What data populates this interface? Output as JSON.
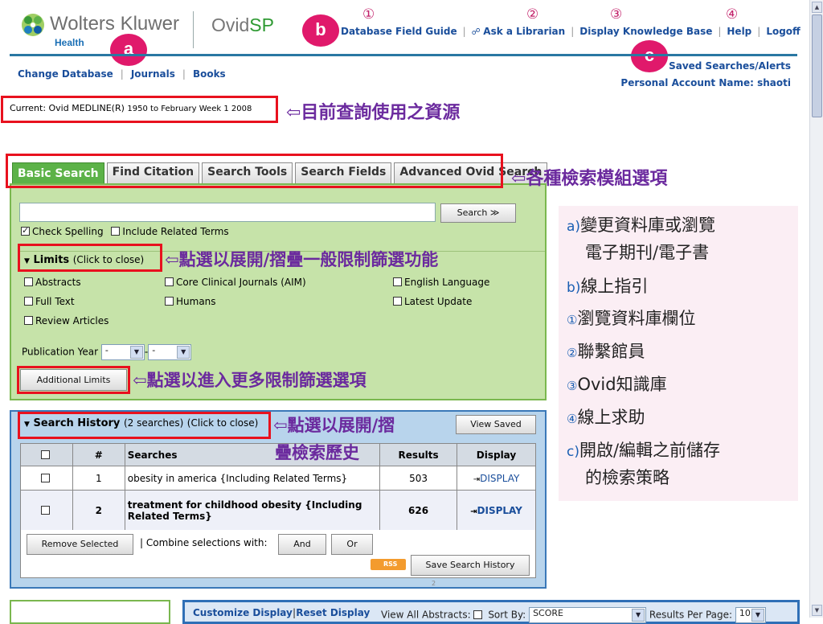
{
  "brand": {
    "name": "Wolters Kluwer",
    "sub": "Health",
    "ovid_a": "Ovid",
    "ovid_b": "SP"
  },
  "markers": {
    "a": "a",
    "b": "b",
    "c": "c",
    "n1": "①",
    "n2": "②",
    "n3": "③",
    "n4": "④"
  },
  "toplinks": {
    "field_guide": "Database Field Guide",
    "librarian": "Ask a Librarian",
    "knowledge": "Display Knowledge Base",
    "help": "Help",
    "logoff": "Logoff"
  },
  "nav": {
    "change_db": "Change Database",
    "journals": "Journals",
    "books": "Books",
    "saved": "Saved Searches/Alerts",
    "account": "Personal Account Name: shaoti"
  },
  "current_db": {
    "label": "Current: Ovid MEDLINE(R)",
    "range": "1950 to February Week 1 2008"
  },
  "annotations": {
    "current": "⇦目前查詢使用之資源",
    "tabs": "⇦各種檢索模組選項",
    "limits": "⇦點選以展開/摺疊一般限制篩選功能",
    "additional": "⇦點選以進入更多限制篩選選項",
    "history1": "⇦點選以展開/摺",
    "history2": "疊檢索歷史"
  },
  "tabs": [
    "Basic Search",
    "Find Citation",
    "Search Tools",
    "Search Fields",
    "Advanced Ovid Search"
  ],
  "search": {
    "input_value": "",
    "button": "Search ≫",
    "check_spelling": "Check Spelling",
    "related_terms": "Include Related Terms"
  },
  "limits": {
    "title": "Limits",
    "sub": "(Click to close)",
    "col1": [
      "Abstracts",
      "Full Text",
      "Review Articles"
    ],
    "col2": [
      "Core Clinical Journals (AIM)",
      "Humans"
    ],
    "col3": [
      "English Language",
      "Latest Update"
    ],
    "pub_year_label": "Publication Year",
    "year_from": "-",
    "year_to": "-",
    "additional_button": "Additional Limits"
  },
  "history": {
    "title": "Search History",
    "count": "(2 searches)",
    "sub": "(Click to close)",
    "view_saved": "View Saved",
    "headers": [
      "#",
      "Searches",
      "Results",
      "Display"
    ],
    "rows": [
      {
        "num": "1",
        "query": "obesity in america {Including Related Terms}",
        "results": "503",
        "display": "DISPLAY"
      },
      {
        "num": "2",
        "query": "treatment for childhood obesity {Including Related Terms}",
        "results": "626",
        "display": "DISPLAY"
      }
    ],
    "remove": "Remove Selected",
    "combine": "| Combine selections with:",
    "and": "And",
    "or": "Or",
    "rss": "RSS",
    "save": "Save Search History",
    "page": "2"
  },
  "legend": {
    "a1": "變更資料庫或瀏覽",
    "a2": "電子期刊/電子書",
    "b": "線上指引",
    "n1": "瀏覽資料庫欄位",
    "n2": "聯繫館員",
    "n3a": "Ovid",
    "n3b": "知識庫",
    "n4": "線上求助",
    "c1": "開啟/編輯之前儲存",
    "c2": "的檢索策略",
    "key_a": "a)",
    "key_b": "b)",
    "key_c": "c)"
  },
  "bottom": {
    "customize": "Customize Display",
    "reset": "Reset Display",
    "view_abstracts": "View All Abstracts:",
    "sort_by": "Sort By:",
    "sort_value": "SCORE",
    "per_page": "Results Per Page:",
    "per_page_value": "10"
  }
}
